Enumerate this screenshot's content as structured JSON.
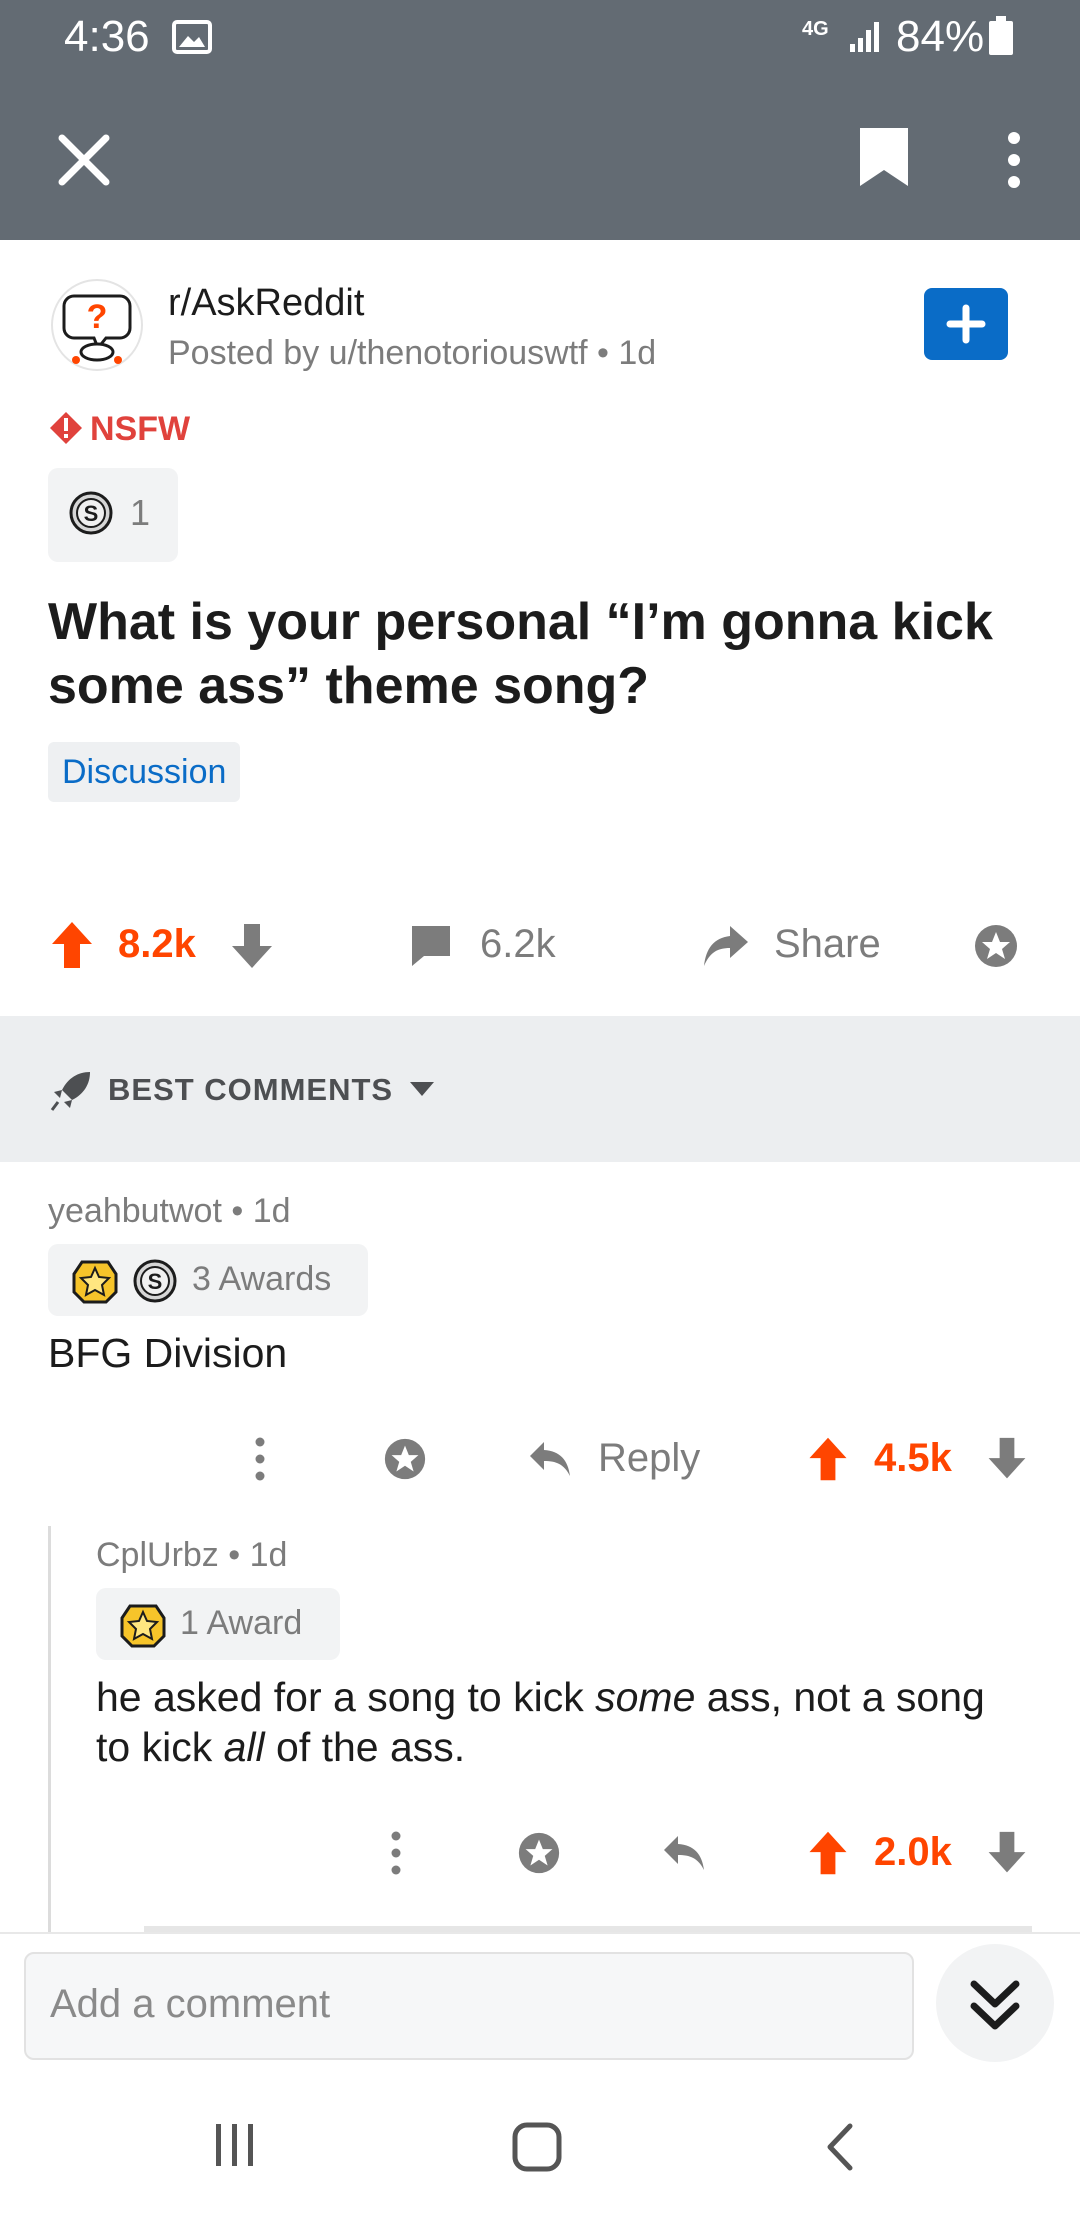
{
  "status_bar": {
    "time": "4:36",
    "battery": "84%",
    "network": "4G"
  },
  "app_bar": {
    "close_icon": "close-icon",
    "bookmark_icon": "bookmark-icon",
    "more_icon": "more-vert-icon"
  },
  "post": {
    "subreddit": "r/AskReddit",
    "posted_by": "Posted by u/thenotoriouswtf",
    "age": "1d",
    "nsfw_label": "NSFW",
    "award_count": "1",
    "title_line1": "What is your personal “I’m gonna kick",
    "title_line2": "some ass” theme song?",
    "flair": "Discussion",
    "upvotes": "8.2k",
    "comments": "6.2k",
    "share_label": "Share"
  },
  "sort": {
    "label": "BEST COMMENTS"
  },
  "comments": [
    {
      "author": "yeahbutwot",
      "age": "1d",
      "awards_label": "3 Awards",
      "body": "BFG Division",
      "reply_label": "Reply",
      "score": "4.5k"
    },
    {
      "author": "CplUrbz",
      "age": "1d",
      "awards_label": "1 Award",
      "body_pre": "he asked for a song to kick ",
      "body_em1": "some",
      "body_mid": " ass, not a song",
      "body_line2_pre": "to kick ",
      "body_em2": "all",
      "body_post": " of the ass.",
      "score": "2.0k"
    }
  ],
  "composer": {
    "placeholder": "Add a comment"
  },
  "colors": {
    "accent_orange": "#ff4500",
    "brand_blue": "#0a6cc7",
    "nsfw_red": "#e0423c",
    "topbar": "#636b73"
  }
}
